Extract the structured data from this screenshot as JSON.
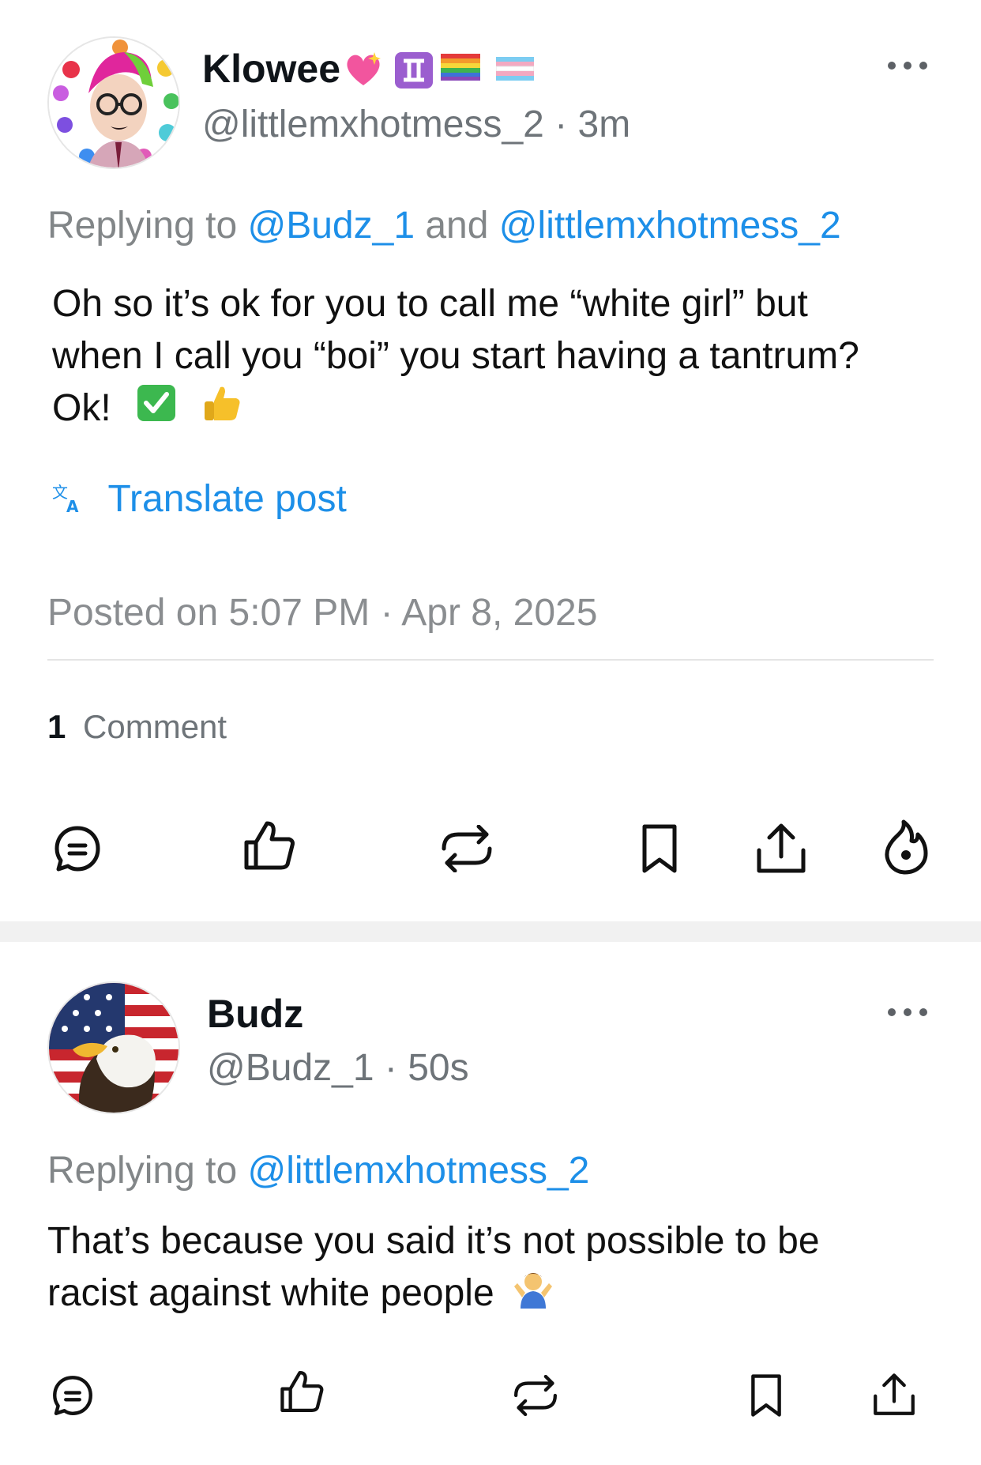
{
  "post1": {
    "author_name": "Klowee",
    "handle": "@littlemxhotmess_2",
    "separator": "·",
    "time": "3m",
    "replying_prefix": "Replying to",
    "mention1": "@Budz_1",
    "conjunction": "and",
    "mention2": "@littlemxhotmess_2",
    "text_line1": "Oh so it’s ok for you to call me “white girl” but",
    "text_line2": "when I call you “boi” you start having a tantrum?",
    "text_line3": "Ok!",
    "translate_label": "Translate post",
    "posted_label": "Posted on 5:07 PM · Apr 8, 2025",
    "comment_count": "1",
    "comment_label": "Comment",
    "icons": [
      "comment-icon",
      "like-icon",
      "repost-icon",
      "bookmark-icon",
      "share-icon",
      "fire-icon"
    ]
  },
  "post2": {
    "author_name": "Budz",
    "handle": "@Budz_1",
    "separator": "·",
    "time": "50s",
    "replying_prefix": "Replying to",
    "mention1": "@littlemxhotmess_2",
    "text_line1": "That’s because you said it’s not possible to be",
    "text_line2": "racist against white people",
    "icons": [
      "comment-icon",
      "like-icon",
      "repost-icon",
      "bookmark-icon",
      "share-icon"
    ]
  },
  "colors": {
    "link": "#1d8fe8",
    "muted": "#828688",
    "text": "#0f1419"
  }
}
